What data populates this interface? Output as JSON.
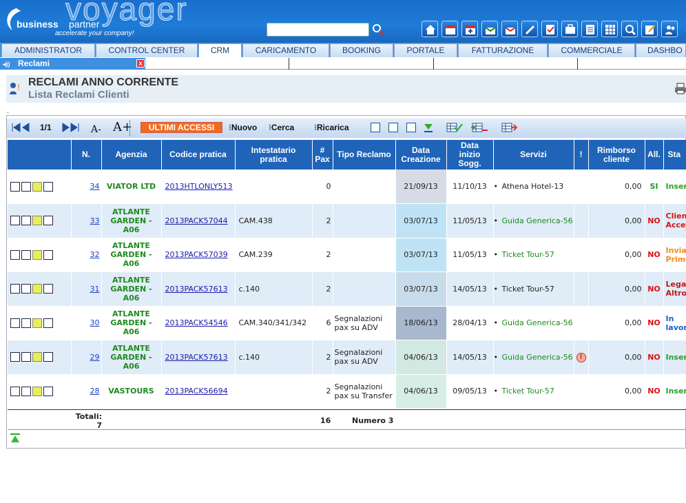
{
  "header": {
    "brand_bold": "business",
    "brand_light": "partner",
    "tagline": "accelerate your company!",
    "product": "voyager",
    "search_value": ""
  },
  "nav_tabs": [
    "ADMINISTRATOR",
    "CONTROL CENTER",
    "CRM",
    "CARICAMENTO",
    "BOOKING",
    "PORTALE",
    "FATTURAZIONE",
    "COMMERCIALE",
    "DASHBO"
  ],
  "active_tab": "CRM",
  "subtab": {
    "label": "Reclami",
    "close": "x"
  },
  "page": {
    "title": "RECLAMI ANNO CORRENTE",
    "subtitle": "Lista Reclami Clienti",
    "dot": "."
  },
  "toolbar": {
    "pages": "1/1",
    "font_small": "A-",
    "font_big": "A+",
    "ultimi": "ULTIMI ACCESSI",
    "nuovo": "Nuovo",
    "cerca": "Cerca",
    "ricarica": "Ricarica"
  },
  "columns": [
    "N.",
    "Agenzia",
    "Codice pratica",
    "Intestatario pratica",
    "# Pax",
    "Tipo Reclamo",
    "Data Creazione",
    "Data inizio Sogg.",
    "Servizi",
    "!",
    "Rimborso cliente",
    "All.",
    "Sta"
  ],
  "rows": [
    {
      "n": "34",
      "agenzia": "VIATOR LTD",
      "codice": "2013HTLONLY513",
      "intestatario": "",
      "pax": "0",
      "tipo": "",
      "data_creazione": "21/09/13",
      "data_inizio": "11/10/13",
      "servizio": "Athena Hotel-13",
      "servizio_color": "#222",
      "alert": "",
      "rimborso": "0,00",
      "all": "SI",
      "all_color": "#1e9a1e",
      "stato": "Inseri",
      "stato2": "",
      "stato_color": "#2aa02a",
      "dc_bg": "#d6dbe6"
    },
    {
      "n": "33",
      "agenzia": "ATLANTE GARDEN - A06",
      "codice": "2013PACK57044",
      "intestatario": "CAM.438",
      "pax": "2",
      "tipo": "",
      "data_creazione": "03/07/13",
      "data_inizio": "11/05/13",
      "servizio": "Guida Generica-56",
      "servizio_color": "#1e8a1e",
      "alert": "",
      "rimborso": "0,00",
      "all": "NO",
      "all_color": "#d11",
      "stato": "Cliente",
      "stato2": "Accetta",
      "stato_color": "#d11",
      "dc_bg": "#bfe3f5"
    },
    {
      "n": "32",
      "agenzia": "ATLANTE GARDEN - A06",
      "codice": "2013PACK57039",
      "intestatario": "CAM.239",
      "pax": "2",
      "tipo": "",
      "data_creazione": "03/07/13",
      "data_inizio": "11/05/13",
      "servizio": "Ticket Tour-57",
      "servizio_color": "#1e8a1e",
      "alert": "",
      "rimborso": "0,00",
      "all": "NO",
      "all_color": "#d11",
      "stato": "Inviat",
      "stato2": "Prima",
      "stato_color": "#f08c1a",
      "dc_bg": "#bfe3f5"
    },
    {
      "n": "31",
      "agenzia": "ATLANTE GARDEN - A06",
      "codice": "2013PACK57613",
      "intestatario": "c.140",
      "pax": "2",
      "tipo": "",
      "data_creazione": "03/07/13",
      "data_inizio": "14/05/13",
      "servizio": "Ticket Tour-57",
      "servizio_color": "#222",
      "alert": "",
      "rimborso": "0,00",
      "all": "NO",
      "all_color": "#d11",
      "stato": "Legale",
      "stato2": "Altro",
      "stato_color": "#c01818",
      "dc_bg": "#c7dcea"
    },
    {
      "n": "30",
      "agenzia": "ATLANTE GARDEN - A06",
      "codice": "2013PACK54546",
      "intestatario": "CAM.340/341/342",
      "pax": "6",
      "tipo": "Segnalazioni pax su ADV",
      "data_creazione": "18/06/13",
      "data_inizio": "28/04/13",
      "servizio": "Guida Generica-56",
      "servizio_color": "#1e8a1e",
      "alert": "",
      "rimborso": "0,00",
      "all": "NO",
      "all_color": "#d11",
      "stato": "In",
      "stato2": "lavora",
      "stato_color": "#1a5fd0",
      "dc_bg": "#a9b8cf"
    },
    {
      "n": "29",
      "agenzia": "ATLANTE GARDEN - A06",
      "codice": "2013PACK57613",
      "intestatario": "c.140",
      "pax": "2",
      "tipo": "Segnalazioni pax su ADV",
      "data_creazione": "04/06/13",
      "data_inizio": "14/05/13",
      "servizio": "Guida Generica-56",
      "servizio_color": "#1e8a1e",
      "alert": "!",
      "rimborso": "0,00",
      "all": "NO",
      "all_color": "#d11",
      "stato": "Inseri",
      "stato2": "",
      "stato_color": "#2aa02a",
      "dc_bg": "#d2e8e2"
    },
    {
      "n": "28",
      "agenzia": "VASTOURS",
      "codice": "2013PACK56694",
      "intestatario": "",
      "pax": "2",
      "tipo": "Segnalazioni pax su Transfer",
      "data_creazione": "04/06/13",
      "data_inizio": "09/05/13",
      "servizio": "Ticket Tour-57",
      "servizio_color": "#1e8a1e",
      "alert": "",
      "rimborso": "0,00",
      "all": "NO",
      "all_color": "#d11",
      "stato": "Inseri",
      "stato2": "",
      "stato_color": "#2aa02a",
      "dc_bg": "#d6eee6"
    }
  ],
  "totals": {
    "label": "Totali:",
    "count": "7",
    "pax": "16",
    "numero": "Numero 3"
  }
}
